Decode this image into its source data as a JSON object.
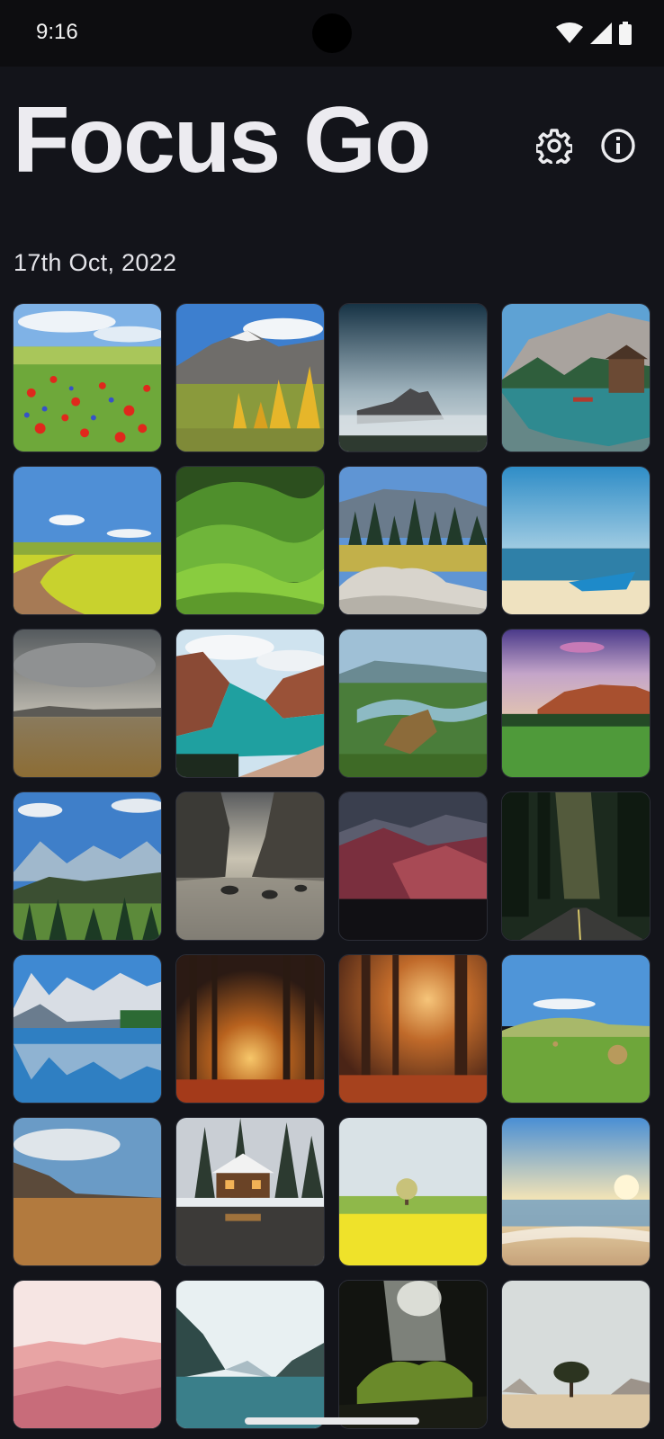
{
  "status_bar": {
    "time": "9:16",
    "icons": [
      "wifi-icon",
      "cell-signal-icon",
      "battery-icon"
    ]
  },
  "header": {
    "title": "Focus Go",
    "settings_icon": "gear-icon",
    "info_icon": "info-icon"
  },
  "date_label": "17th Oct, 2022",
  "wallpapers": [
    {
      "name": "poppy-field"
    },
    {
      "name": "autumn-mountain"
    },
    {
      "name": "misty-peak"
    },
    {
      "name": "lake-boathouse"
    },
    {
      "name": "rapeseed-path"
    },
    {
      "name": "green-hills"
    },
    {
      "name": "pine-forest-rocks"
    },
    {
      "name": "beach-boat"
    },
    {
      "name": "stormy-prairie"
    },
    {
      "name": "turquoise-river"
    },
    {
      "name": "river-canyon"
    },
    {
      "name": "purple-dusk-mesa"
    },
    {
      "name": "alpine-valley"
    },
    {
      "name": "sea-cliffs"
    },
    {
      "name": "red-mountains"
    },
    {
      "name": "forest-road"
    },
    {
      "name": "mountain-lake-reflection"
    },
    {
      "name": "glowing-forest"
    },
    {
      "name": "autumn-woods-sun"
    },
    {
      "name": "hay-bales-field"
    },
    {
      "name": "golden-grassland"
    },
    {
      "name": "snowy-cabin"
    },
    {
      "name": "yellow-field-tree"
    },
    {
      "name": "sunset-beach"
    },
    {
      "name": "pink-haze-hills"
    },
    {
      "name": "glacial-lake"
    },
    {
      "name": "cave-light"
    },
    {
      "name": "desert-tree"
    }
  ],
  "colors": {
    "background": "#13141a",
    "status_bar": "#0d0d10",
    "title": "#ecebf0"
  }
}
